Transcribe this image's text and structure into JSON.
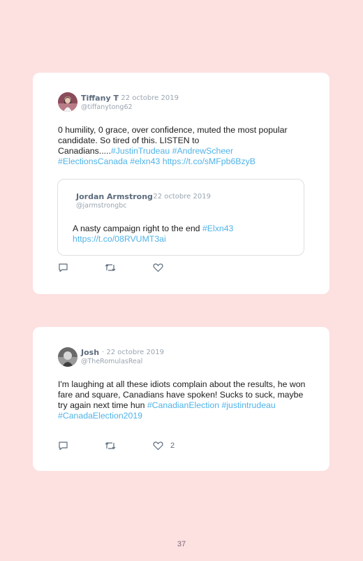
{
  "tweets": [
    {
      "name": "Tiffany T",
      "date": "· 22 octobre 2019",
      "handle": "@tiffanytong62",
      "text_plain": "0 humility, 0 grace, over confidence, muted the most popular candidate. So tired of this. LISTEN to Canadians.....",
      "tags": [
        "#JustinTrudeau",
        "#AndrewScheer",
        "#ElectionsCanada",
        "#elxn43",
        "https://t.co/sMFpb6BzyB"
      ],
      "quoted": {
        "name": "Jordan Armstrong",
        "date": "· 22 octobre 2019",
        "handle": "@jarmstrongbc",
        "text_plain": "A nasty campaign right to the end",
        "tags": [
          "#Elxn43",
          "https://t.co/08RVUMT3ai"
        ]
      },
      "like_count": ""
    },
    {
      "name": "Josh",
      "date": "· 22 octobre 2019",
      "handle": "@TheRomulasReal",
      "text_plain": "I'm laughing at all these idiots complain about the results, he won fare and square, Canadians have spoken! Sucks to suck, maybe try again next time hun",
      "tags": [
        "#CanadianElection",
        "#justintrudeau",
        "#CanadaElection2019"
      ],
      "like_count": "2"
    }
  ],
  "icons": [
    "reply-icon",
    "retweet-icon",
    "like-icon"
  ],
  "colors": {
    "background": "#fde0e0",
    "card": "#ffffff",
    "link": "#4fb3e8",
    "name": "#5b6b7c"
  },
  "page_number": "37"
}
